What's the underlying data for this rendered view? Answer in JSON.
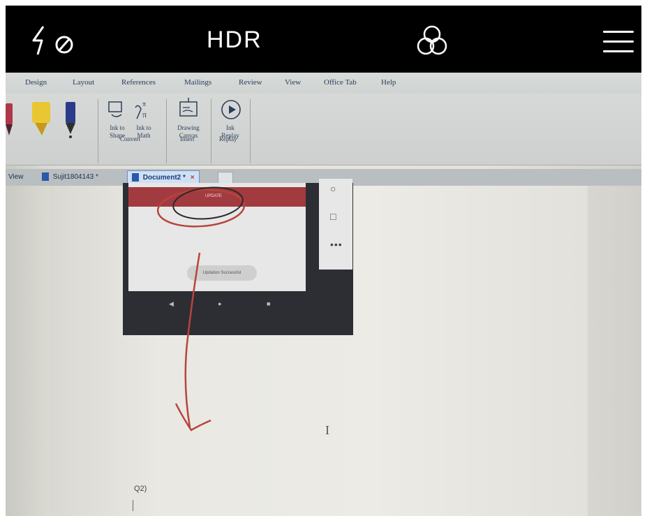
{
  "camera": {
    "flash_icon": "flash-off-icon",
    "hdr_label": "HDR",
    "filters_icon": "filters-icon",
    "menu_icon": "hamburger-menu-icon",
    "bar_color": "#000000"
  },
  "ribbon": {
    "tabs": [
      "Design",
      "Layout",
      "References",
      "Mailings",
      "Review",
      "View",
      "Office Tab",
      "Help"
    ],
    "items": {
      "ink_to_shape": "Ink to\nShape",
      "ink_to_math": "Ink to\nMath",
      "drawing_canvas": "Drawing\nCanvas",
      "ink_replay": "Ink\nReplay"
    },
    "groups": [
      "Convert",
      "Insert",
      "Replay"
    ]
  },
  "doc_tabs": {
    "view_label": "View",
    "tab1": "Sujit1804143 *",
    "tab2": "Document2 *",
    "close": "×"
  },
  "screenshot_content": {
    "red_bar_text": "UPDATE",
    "toast_text": "Updation Successful"
  },
  "document": {
    "q2_label": "Q2)"
  },
  "colors": {
    "ink_red": "#b8443c",
    "ink_dark": "#2a2a2a",
    "red_bar": "#a23b3f"
  }
}
